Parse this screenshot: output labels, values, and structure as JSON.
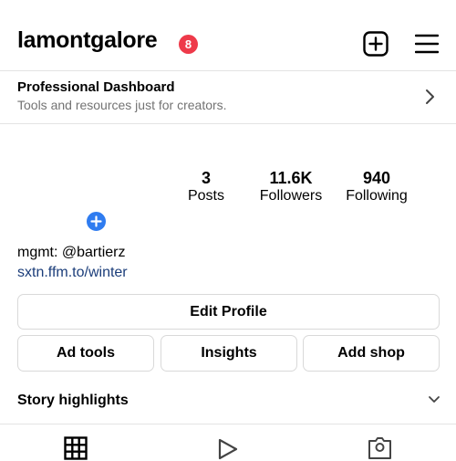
{
  "header": {
    "username": "lamontgalore",
    "notification_count": "8"
  },
  "dashboard": {
    "title": "Professional Dashboard",
    "subtitle": "Tools and resources just for creators."
  },
  "stats": [
    {
      "value": "3",
      "label": "Posts"
    },
    {
      "value": "11.6K",
      "label": "Followers"
    },
    {
      "value": "940",
      "label": "Following"
    }
  ],
  "bio": {
    "text": "mgmt: @bartierz",
    "link": "sxtn.ffm.to/winter"
  },
  "buttons": {
    "edit_profile": "Edit Profile",
    "ad_tools": "Ad tools",
    "insights": "Insights",
    "add_shop": "Add shop"
  },
  "highlights": {
    "title": "Story highlights"
  },
  "colors": {
    "badge": "#ee3a4a",
    "add_story": "#2f7cf0",
    "link": "#1b3d7a",
    "secondary_text": "#737373"
  },
  "icons": {
    "create": "plus-square-icon",
    "menu": "hamburger-menu-icon",
    "dashboard": "chevron-right-icon",
    "highlights": "chevron-down-icon",
    "tabs": [
      "grid-icon",
      "reels-icon",
      "tagged-icon"
    ]
  }
}
